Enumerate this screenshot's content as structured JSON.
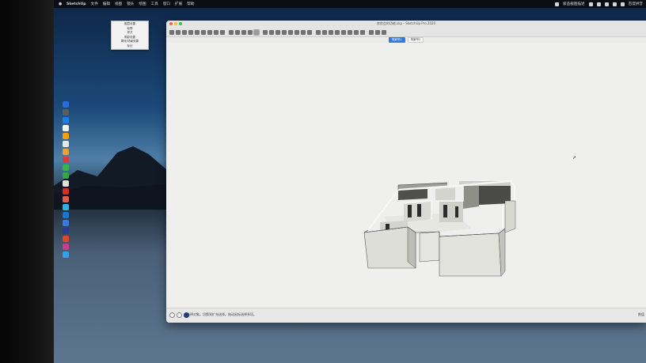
{
  "menubar": {
    "app_name": "SketchUp",
    "items": [
      "文件",
      "编辑",
      "视图",
      "镜头",
      "绘图",
      "工具",
      "窗口",
      "扩展",
      "帮助"
    ],
    "status_text": "极品截图描述",
    "ime": "百度拼音"
  },
  "context_menu": {
    "items": [
      "图层设置",
      "轮廓",
      "样式",
      "阴影设置",
      "雾化/场景效果",
      "标记"
    ]
  },
  "dock": {
    "icon_colors": [
      "#2a6bd6",
      "#5c5c5c",
      "#1e7ee8",
      "#f2f2f2",
      "#ff9e00",
      "#e8e8e8",
      "#f0a030",
      "#dd3b3b",
      "#34b54a",
      "#2fa84a",
      "#e0e0e0",
      "#d92b2b",
      "#e35b4f",
      "#2bb3e6",
      "#1a75d2",
      "#3b7bd9",
      "#2b3b8f",
      "#e2452b",
      "#cf3a8b",
      "#2fa3e6"
    ]
  },
  "window": {
    "title": "库房会的功能.skp - SketchUp Pro 2020",
    "tabs": [
      {
        "label": "场景号1",
        "active": true
      },
      {
        "label": "场景号2",
        "active": false
      }
    ]
  },
  "status": {
    "message": "选择对象。切换到扩充选择。拖动鼠标选择多项。",
    "right": "数值"
  },
  "colors": {
    "accent": "#2f7ae5",
    "canvas": "#efefed",
    "wall": "#dededb",
    "wall_dark": "#4a4a48"
  }
}
